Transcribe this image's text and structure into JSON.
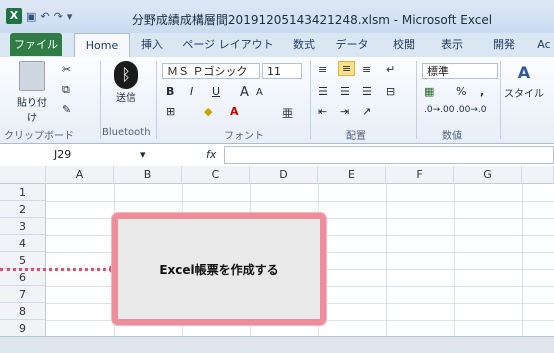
{
  "window": {
    "title": "分野成績成構層間20191205143421248.xlsm - Microsoft Excel",
    "app_icon_label": "X"
  },
  "tabs": [
    "ファイル",
    "Home",
    "挿入",
    "ページ レイアウト",
    "数式",
    "データ",
    "校閲",
    "表示",
    "開発",
    "Ac"
  ],
  "ribbon": {
    "clipboard": {
      "paste": "貼り付け",
      "group": "クリップボード"
    },
    "bluetooth": {
      "send": "送信",
      "group": "Bluetooth"
    },
    "font": {
      "name": "ＭＳ Ｐゴシック",
      "size": "11",
      "bold": "B",
      "italic": "I",
      "underline": "U",
      "grow": "A",
      "shrink": "A",
      "group": "フォント"
    },
    "alignment": {
      "group": "配置"
    },
    "number": {
      "format": "標準",
      "percent": "%",
      "comma": ",",
      "group": "数値"
    },
    "styles": {
      "label": "スタイル"
    }
  },
  "formula_bar": {
    "name_box": "J29",
    "fx": "fx",
    "value": ""
  },
  "columns": [
    "A",
    "B",
    "C",
    "D",
    "E",
    "F",
    "G"
  ],
  "rows": [
    "1",
    "2",
    "3",
    "4",
    "5",
    "6",
    "7",
    "8",
    "9"
  ],
  "shape": {
    "text": "Excel帳票を作成する"
  }
}
